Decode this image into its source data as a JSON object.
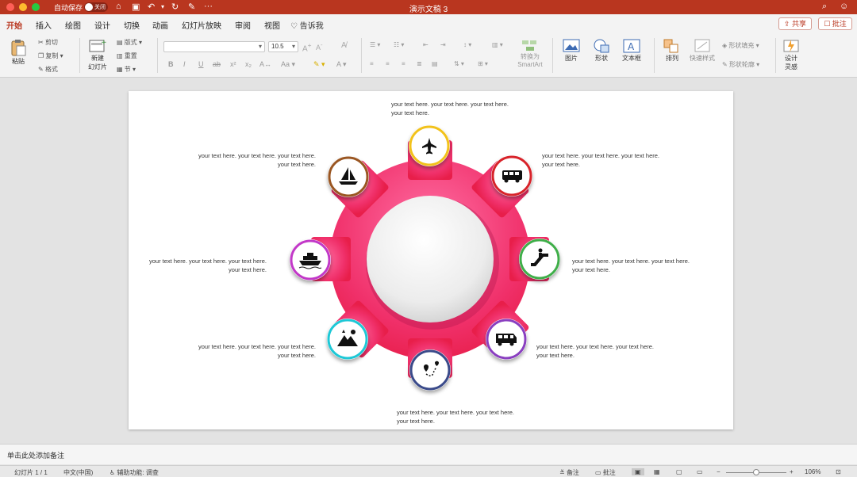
{
  "titlebar": {
    "autosave_label": "自动保存",
    "toggle_label": "关闭",
    "window_title": "演示文稿 3"
  },
  "tabs": [
    "开始",
    "插入",
    "绘图",
    "设计",
    "切换",
    "动画",
    "幻灯片放映",
    "审阅",
    "视图"
  ],
  "tell_me": "告诉我",
  "share": "共享",
  "comment": "批注",
  "ribbon": {
    "paste": "粘贴",
    "cut": "剪切",
    "copy": "复制",
    "format": "格式",
    "new_slide_1": "新建",
    "new_slide_2": "幻灯片",
    "layout": "版式",
    "reset": "重置",
    "section": "节",
    "font_size": "10.5",
    "convert_smartart_1": "转换为",
    "convert_smartart_2": "SmartArt",
    "picture": "图片",
    "shape": "形状",
    "textbox": "文本框",
    "arrange": "排列",
    "quick_styles": "快速样式",
    "shape_fill": "形状填充",
    "shape_outline": "形状轮廓",
    "design_ideas_1": "设计",
    "design_ideas_2": "灵感"
  },
  "slide": {
    "text_top": "your text here. your text here. your text here. your text here.",
    "text_tr": "your text here. your text here. your text here. your text here.",
    "text_r": "your text here. your text here. your text here. your text here.",
    "text_br": "your text here. your text here. your text here. your text here.",
    "text_bottom": "your text here. your text here. your text here. your text here.",
    "text_bl": "your text here. your text here. your text here. your text here.",
    "text_l": "your text here. your text here. your text here. your text here.",
    "text_tl": "your text here. your text here. your text here. your text here.",
    "icons": [
      "airplane-icon",
      "bus-icon",
      "escalator-icon",
      "rv-camper-icon",
      "route-icon",
      "mountain-camping-icon",
      "cruise-ship-icon",
      "sailboat-icon"
    ],
    "ring_colors": [
      "#f2c21b",
      "#d8232a",
      "#3fae49",
      "#8a3fc0",
      "#3a4a8a",
      "#1ec8d6",
      "#c238c8",
      "#9a5622"
    ],
    "gear_color": "#f0306a"
  },
  "notes": "单击此处添加备注",
  "status": {
    "slide_count": "幻灯片 1 / 1",
    "language": "中文(中国)",
    "accessibility": "辅助功能: 调查",
    "notes": "备注",
    "comments": "批注",
    "zoom": "106%"
  }
}
